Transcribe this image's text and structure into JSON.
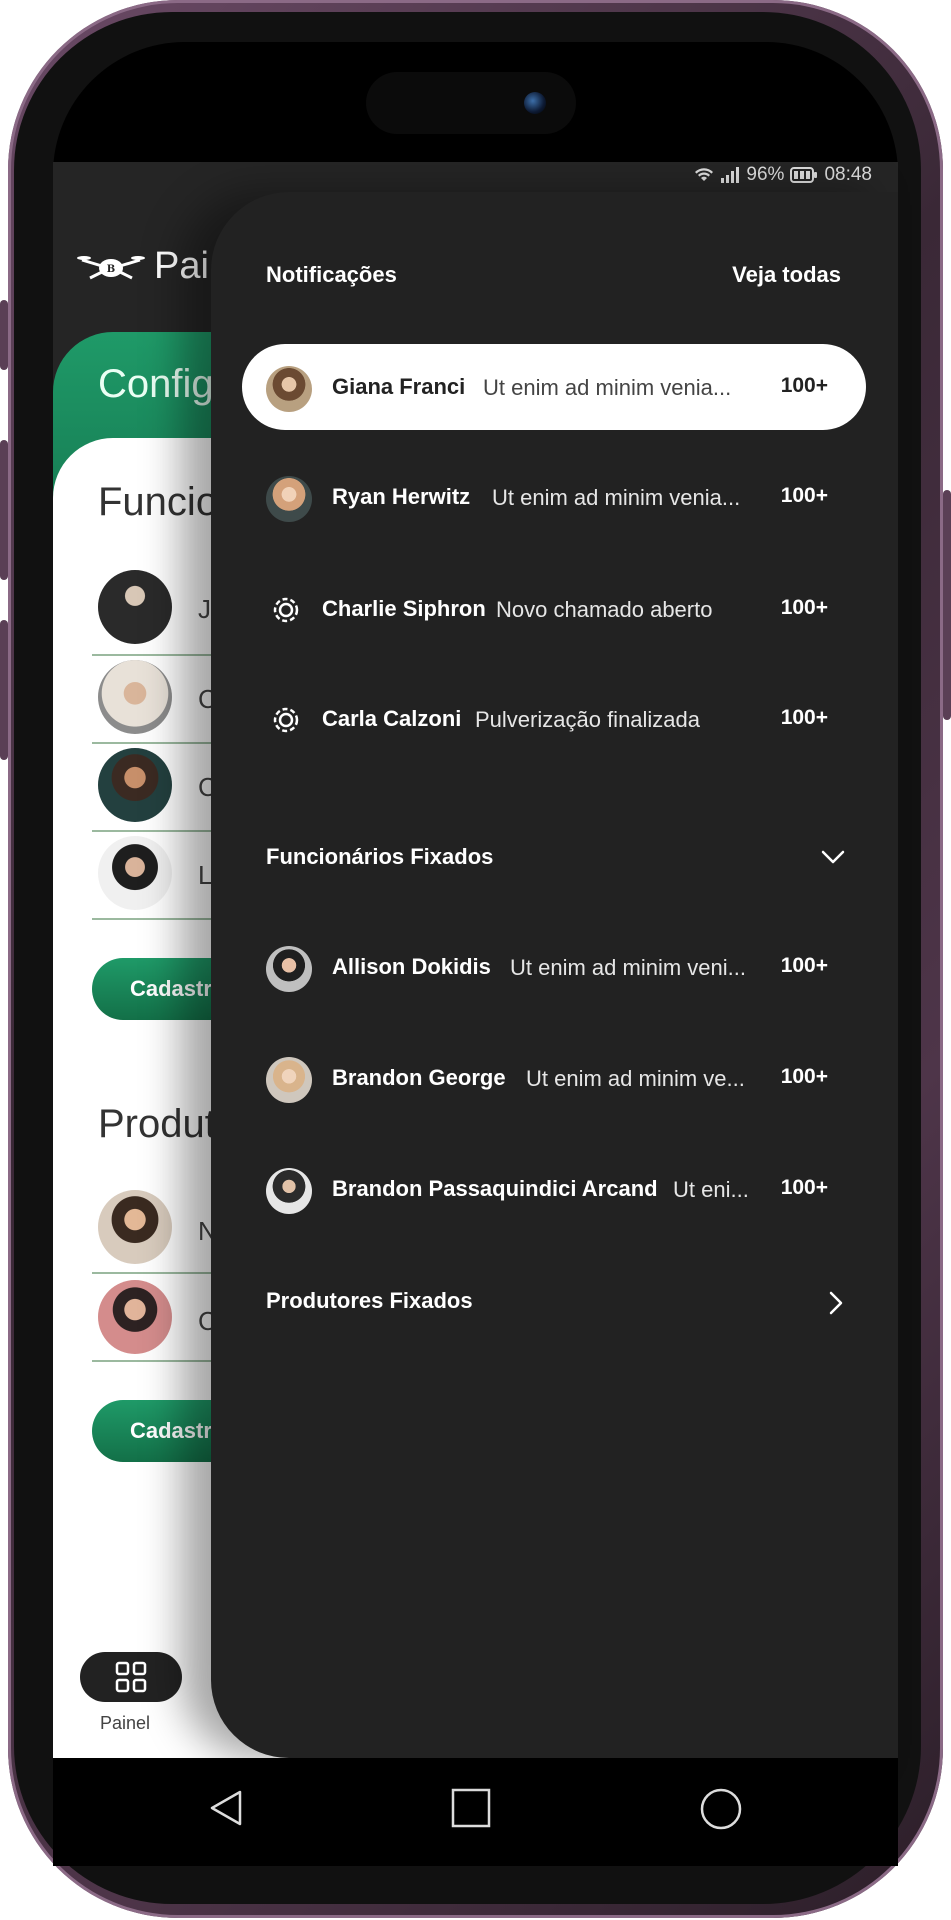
{
  "status_bar": {
    "battery": "96%",
    "time": "08:48"
  },
  "background_app": {
    "title": "Pai",
    "card_title": "Config",
    "section_funcionarios": "Funcio",
    "section_produtores": "Produt",
    "funcionarios_letters": [
      "J",
      "C",
      "C",
      "L"
    ],
    "produtores_letters": [
      "N",
      "C"
    ],
    "register_button_1": "Cadastra",
    "register_button_2": "Cadastra",
    "nav_label": "Painel"
  },
  "drawer": {
    "header": {
      "title": "Notificações",
      "see_all": "Veja todas"
    },
    "notifications": [
      {
        "name": "Giana Franci",
        "message": "Ut enim ad minim venia...",
        "count": "100+",
        "icon": "avatar"
      },
      {
        "name": "Ryan Herwitz",
        "message": "Ut enim ad minim venia...",
        "count": "100+",
        "icon": "avatar"
      },
      {
        "name": "Charlie Siphron",
        "message": "Novo chamado aberto",
        "count": "100+",
        "icon": "gear-icon"
      },
      {
        "name": "Carla Calzoni",
        "message": "Pulverização finalizada",
        "count": "100+",
        "icon": "gear-icon"
      }
    ],
    "pinned_employees": {
      "title": "Funcionários Fixados",
      "items": [
        {
          "name": "Allison Dokidis",
          "message": "Ut enim ad minim veni...",
          "count": "100+"
        },
        {
          "name": "Brandon George",
          "message": "Ut enim ad minim ve...",
          "count": "100+"
        },
        {
          "name": "Brandon Passaquindici Arcand",
          "message": "Ut eni...",
          "count": "100+"
        }
      ]
    },
    "pinned_producers": {
      "title": "Produtores Fixados"
    }
  },
  "colors": {
    "accent_green": "#1f9a68",
    "drawer_bg": "#222222",
    "active_row": "#ffffff"
  }
}
